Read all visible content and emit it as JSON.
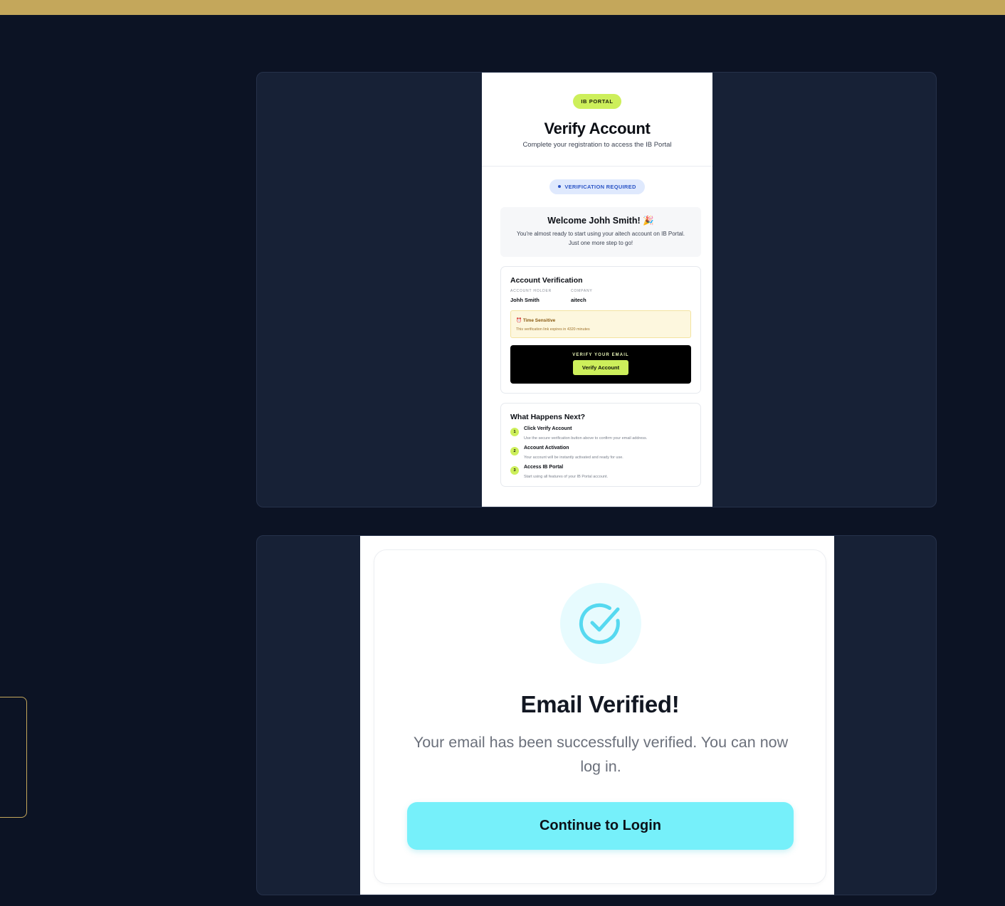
{
  "email_preview": {
    "portal_badge": "IB PORTAL",
    "title": "Verify Account",
    "subtitle": "Complete your registration to access the IB Portal",
    "status_badge": "VERIFICATION REQUIRED",
    "welcome_title": "Welcome Johh Smith! 🎉",
    "welcome_text": "You're almost ready to start using your aitech account on IB Portal. Just one more step to go!",
    "account_card": {
      "title": "Account Verification",
      "holder_label": "ACCOUNT HOLDER",
      "holder_value": "Johh Smith",
      "company_label": "COMPANY",
      "company_value": "aitech",
      "notice_title": "⏰ Time Sensitive",
      "notice_text": "This verification link expires in 4320 minutes",
      "cta_label": "VERIFY YOUR EMAIL",
      "cta_button": "Verify Account"
    },
    "next_steps": {
      "title": "What Happens Next?",
      "items": [
        {
          "num": "1",
          "title": "Click Verify Account",
          "desc": "Use the secure verification button above to confirm your email address."
        },
        {
          "num": "2",
          "title": "Account Activation",
          "desc": "Your account will be instantly activated and ready for use."
        },
        {
          "num": "3",
          "title": "Access IB Portal",
          "desc": "Start using all features of your IB Portal account."
        }
      ]
    }
  },
  "verified_page": {
    "icon": "check-circle-icon",
    "title": "Email Verified!",
    "message": "Your email has been successfully verified. You can now log in.",
    "button": "Continue to Login"
  },
  "colors": {
    "background": "#0c1324",
    "gold_accent": "#c4a75b",
    "lime": "#cdef5b",
    "cyan": "#76f0fa"
  }
}
